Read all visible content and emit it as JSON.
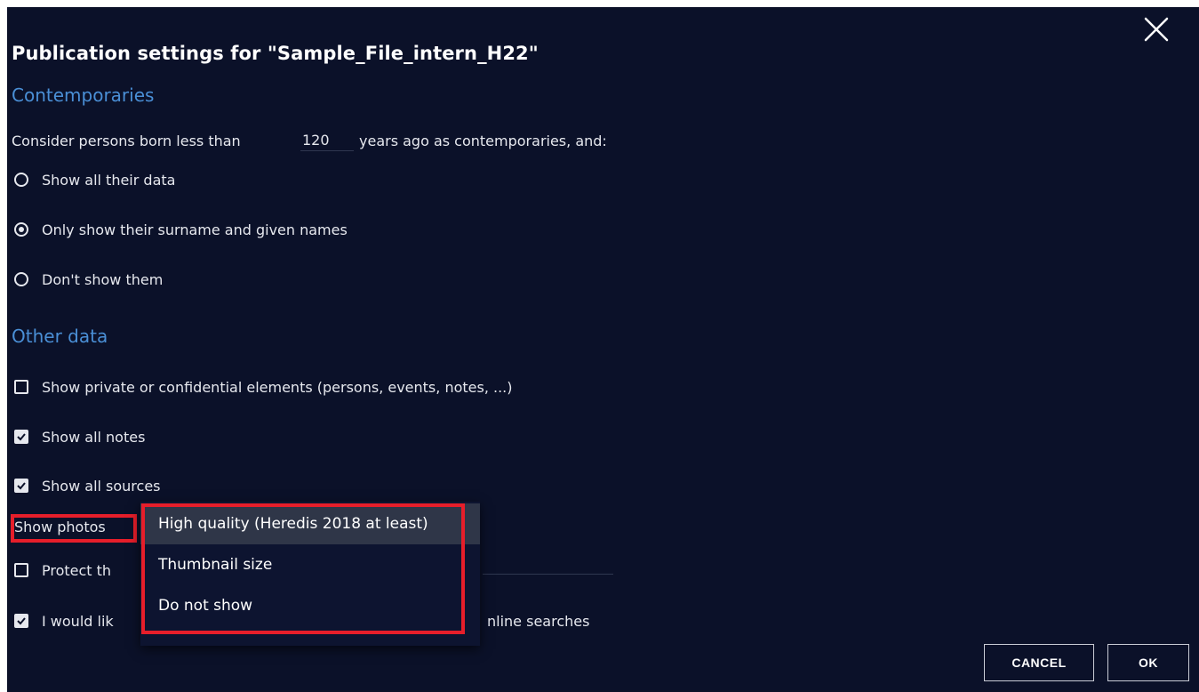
{
  "dialog": {
    "title": "Publication settings for \"Sample_File_intern_H22\"",
    "close_icon": "close-icon"
  },
  "contemporaries": {
    "heading": "Contemporaries",
    "consider_prefix": "Consider persons born less than",
    "years_value": "120",
    "consider_suffix": "years ago as contemporaries, and:",
    "options": [
      {
        "label": "Show all their data",
        "checked": false
      },
      {
        "label": "Only show their surname and given names",
        "checked": true
      },
      {
        "label": "Don't show them",
        "checked": false
      }
    ]
  },
  "other_data": {
    "heading": "Other data",
    "checkboxes": [
      {
        "label": "Show private or confidential elements (persons, events, notes, ...)",
        "checked": false
      },
      {
        "label": "Show all notes",
        "checked": true
      },
      {
        "label": "Show all sources",
        "checked": true
      }
    ],
    "show_photos_label": "Show photos",
    "protect_label_partial": "Protect th",
    "would_like_partial": "I would lik",
    "would_like_suffix": "nline searches",
    "protect_checked": false,
    "would_like_checked": true
  },
  "photos_dropdown": {
    "options": [
      {
        "label": "High quality (Heredis 2018 at least)",
        "selected": true
      },
      {
        "label": "Thumbnail size",
        "selected": false
      },
      {
        "label": "Do not show",
        "selected": false
      }
    ]
  },
  "footer": {
    "cancel_label": "CANCEL",
    "ok_label": "OK"
  },
  "colors": {
    "background": "#0b1129",
    "heading": "#4a8fd6",
    "highlight": "#e61e2a"
  }
}
